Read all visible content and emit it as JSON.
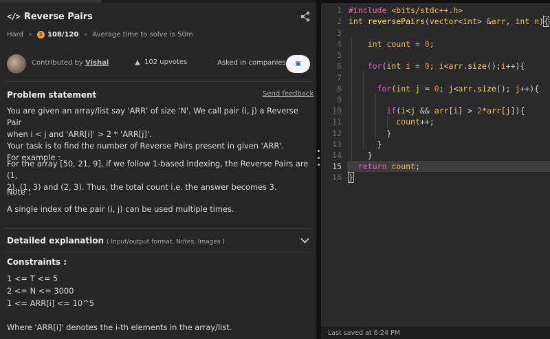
{
  "problem": {
    "title": "Reverse Pairs",
    "difficulty": "Hard",
    "score": "108/120",
    "avg_time": "Average time to solve is 50m"
  },
  "contributor": {
    "prefix": "Contributed by",
    "name": "Vishal",
    "upvotes": "102 upvotes",
    "asked_label": "Asked in companies"
  },
  "statement": {
    "heading": "Problem statement",
    "feedback": "Send feedback",
    "lines": [
      "You are given an array/list say 'ARR' of size 'N'. We call pair (i, j) a Reverse Pair",
      "when i < j and 'ARR[i]' > 2 * 'ARR[j]'.",
      "Your task is to find the number of Reverse Pairs present in given 'ARR'.",
      "For example :"
    ],
    "example_lines": [
      "For the array [50, 21, 9], if we follow 1-based indexing, the Reverse Pairs are (1,",
      "2), (1, 3) and (2, 3). Thus, the total count i.e. the answer becomes 3."
    ],
    "note_label": "Note :",
    "note": "A single index of the pair (i, j) can be used multiple times."
  },
  "detailed": {
    "title": "Detailed explanation",
    "subtitle": "( Input/output format, Notes, Images )"
  },
  "constraints": {
    "title": "Constraints :",
    "items": [
      "1 <= T <= 5",
      "2 <= N <= 3000",
      "1 <= ARR[i] <= 10^5"
    ],
    "footer": "Where 'ARR[i]' denotes the i-th elements in the array/list."
  },
  "editor": {
    "line_numbers": [
      "1",
      "2",
      "3",
      "4",
      "5",
      "6",
      "7",
      "8",
      "9",
      "10",
      "11",
      "12",
      "13",
      "14",
      "15",
      "16"
    ],
    "highlighted_line": "15",
    "status": "Last saved at 6:24 PM"
  },
  "colors": {
    "panel": "#262626",
    "editor": "#2a2a2a",
    "coin": "#f0a92e"
  },
  "icons": {
    "header": "code-icon",
    "share": "share-icon",
    "upvote": "arrow-up-icon",
    "expand": "chevron-down-icon"
  }
}
